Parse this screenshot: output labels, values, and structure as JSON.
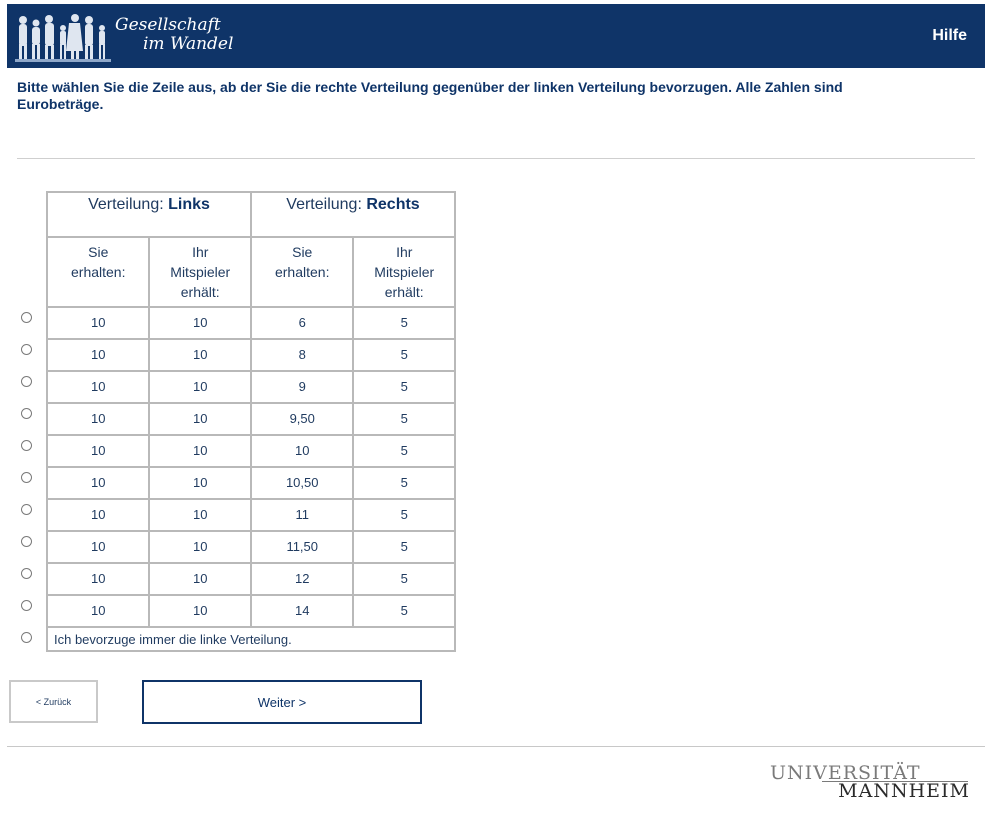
{
  "header": {
    "logo_line1": "Gesellschaft",
    "logo_line2": "im Wandel",
    "help_label": "Hilfe"
  },
  "instruction": "Bitte wählen Sie die Zeile aus, ab der Sie die rechte Verteilung gegenüber der linken Verteilung bevorzugen. Alle Zahlen sind Eurobeträge.",
  "table": {
    "left_group_prefix": "Verteilung: ",
    "left_group_name": "Links",
    "right_group_prefix": "Verteilung: ",
    "right_group_name": "Rechts",
    "col_you_l1": "Sie",
    "col_you_l2": "erhalten:",
    "col_partner_l1": "Ihr",
    "col_partner_l2": "Mitspieler",
    "col_partner_l3": "erhält:",
    "rows": [
      {
        "left_you": "10",
        "left_partner": "10",
        "right_you": "6",
        "right_partner": "5"
      },
      {
        "left_you": "10",
        "left_partner": "10",
        "right_you": "8",
        "right_partner": "5"
      },
      {
        "left_you": "10",
        "left_partner": "10",
        "right_you": "9",
        "right_partner": "5"
      },
      {
        "left_you": "10",
        "left_partner": "10",
        "right_you": "9,50",
        "right_partner": "5"
      },
      {
        "left_you": "10",
        "left_partner": "10",
        "right_you": "10",
        "right_partner": "5"
      },
      {
        "left_you": "10",
        "left_partner": "10",
        "right_you": "10,50",
        "right_partner": "5"
      },
      {
        "left_you": "10",
        "left_partner": "10",
        "right_you": "11",
        "right_partner": "5"
      },
      {
        "left_you": "10",
        "left_partner": "10",
        "right_you": "11,50",
        "right_partner": "5"
      },
      {
        "left_you": "10",
        "left_partner": "10",
        "right_you": "12",
        "right_partner": "5"
      },
      {
        "left_you": "10",
        "left_partner": "10",
        "right_you": "14",
        "right_partner": "5"
      }
    ],
    "always_left_label": "Ich bevorzuge immer die linke Verteilung."
  },
  "buttons": {
    "back_label": "< Zurück",
    "next_label": "Weiter >"
  },
  "footer": {
    "uni_line1": "UNIVERSITÄT",
    "uni_line2": "MANNHEIM"
  },
  "colors": {
    "brand_navy": "#0f3468",
    "text_navy": "#1f3a5f",
    "border_gray": "#b9b9b9"
  }
}
